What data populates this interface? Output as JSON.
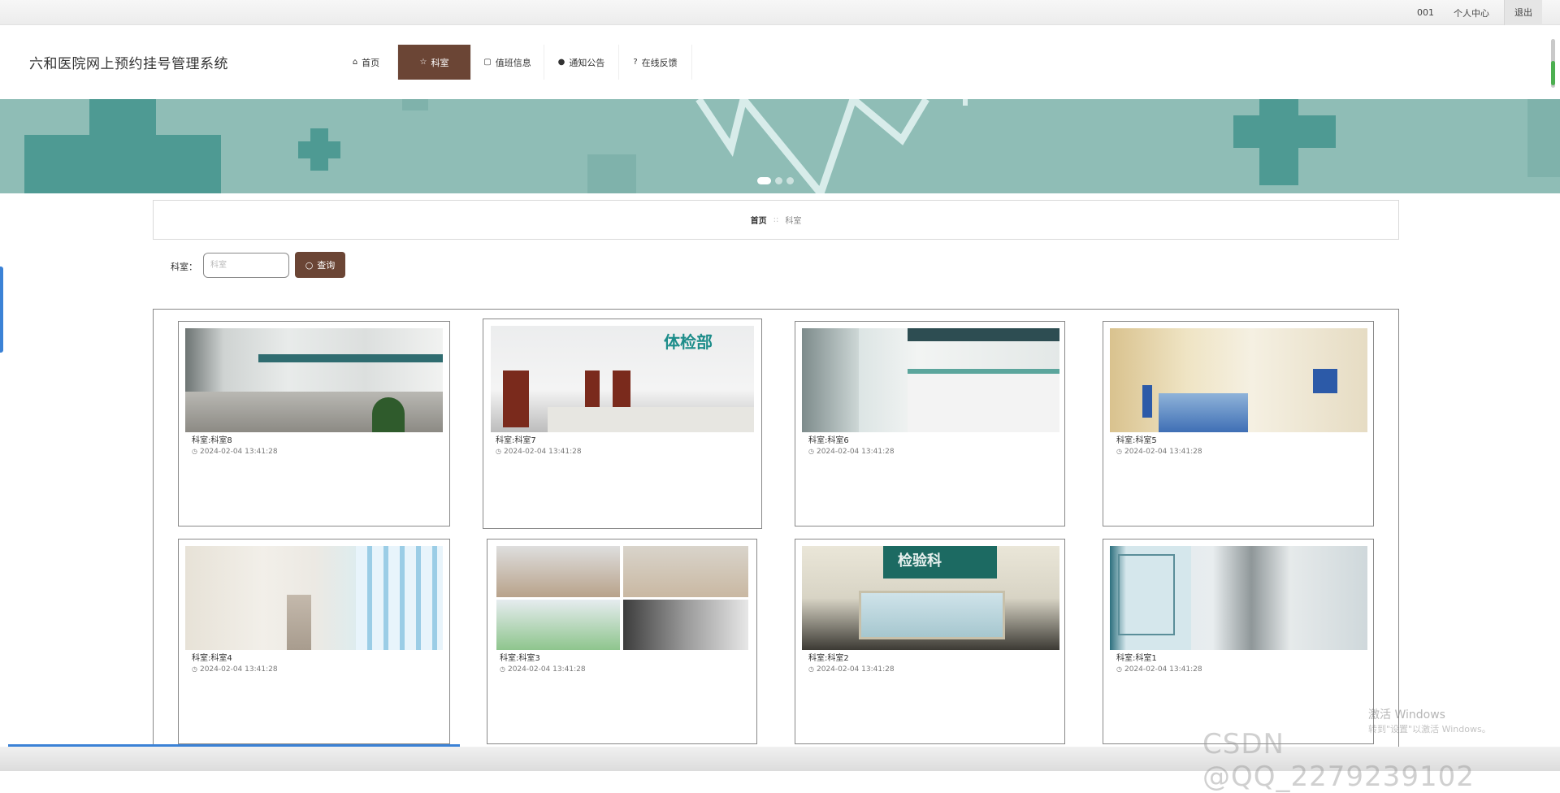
{
  "topbar": {
    "user": "001",
    "profile": "个人中心",
    "logout": "退出"
  },
  "site": {
    "title": "六和医院网上预约挂号管理系统"
  },
  "nav": [
    {
      "label": "首页",
      "icon": "home-icon",
      "active": false
    },
    {
      "label": "科室",
      "icon": "star-icon",
      "active": true
    },
    {
      "label": "值班信息",
      "icon": "bag-icon",
      "active": false
    },
    {
      "label": "通知公告",
      "icon": "info-icon",
      "active": false
    },
    {
      "label": "在线反馈",
      "icon": "question-icon",
      "active": false
    }
  ],
  "banner": {
    "slides": 3,
    "active_slide": 0
  },
  "breadcrumb": {
    "home": "首页",
    "sep": "::",
    "current": "科室"
  },
  "search": {
    "label": "科室：",
    "placeholder": "科室",
    "button": "查询"
  },
  "cards": [
    {
      "name": "科室:科室8",
      "time": "2024-02-04 13:41:28"
    },
    {
      "name": "科室:科室7",
      "time": "2024-02-04 13:41:28"
    },
    {
      "name": "科室:科室6",
      "time": "2024-02-04 13:41:28"
    },
    {
      "name": "科室:科室5",
      "time": "2024-02-04 13:41:28"
    },
    {
      "name": "科室:科室4",
      "time": "2024-02-04 13:41:28"
    },
    {
      "name": "科室:科室3",
      "time": "2024-02-04 13:41:28"
    },
    {
      "name": "科室:科室2",
      "time": "2024-02-04 13:41:28"
    },
    {
      "name": "科室:科室1",
      "time": "2024-02-04 13:41:28"
    }
  ],
  "photo_signs": {
    "card2": "体检部",
    "card7": "检验科"
  },
  "overlay": {
    "activate_title": "激活 Windows",
    "activate_sub": "转到\"设置\"以激活 Windows。",
    "csdn": "CSDN @QQ_2279239102"
  },
  "colors": {
    "accent": "#6b4535",
    "banner": "#8fbdb6",
    "banner_cross": "#4e9a93"
  }
}
